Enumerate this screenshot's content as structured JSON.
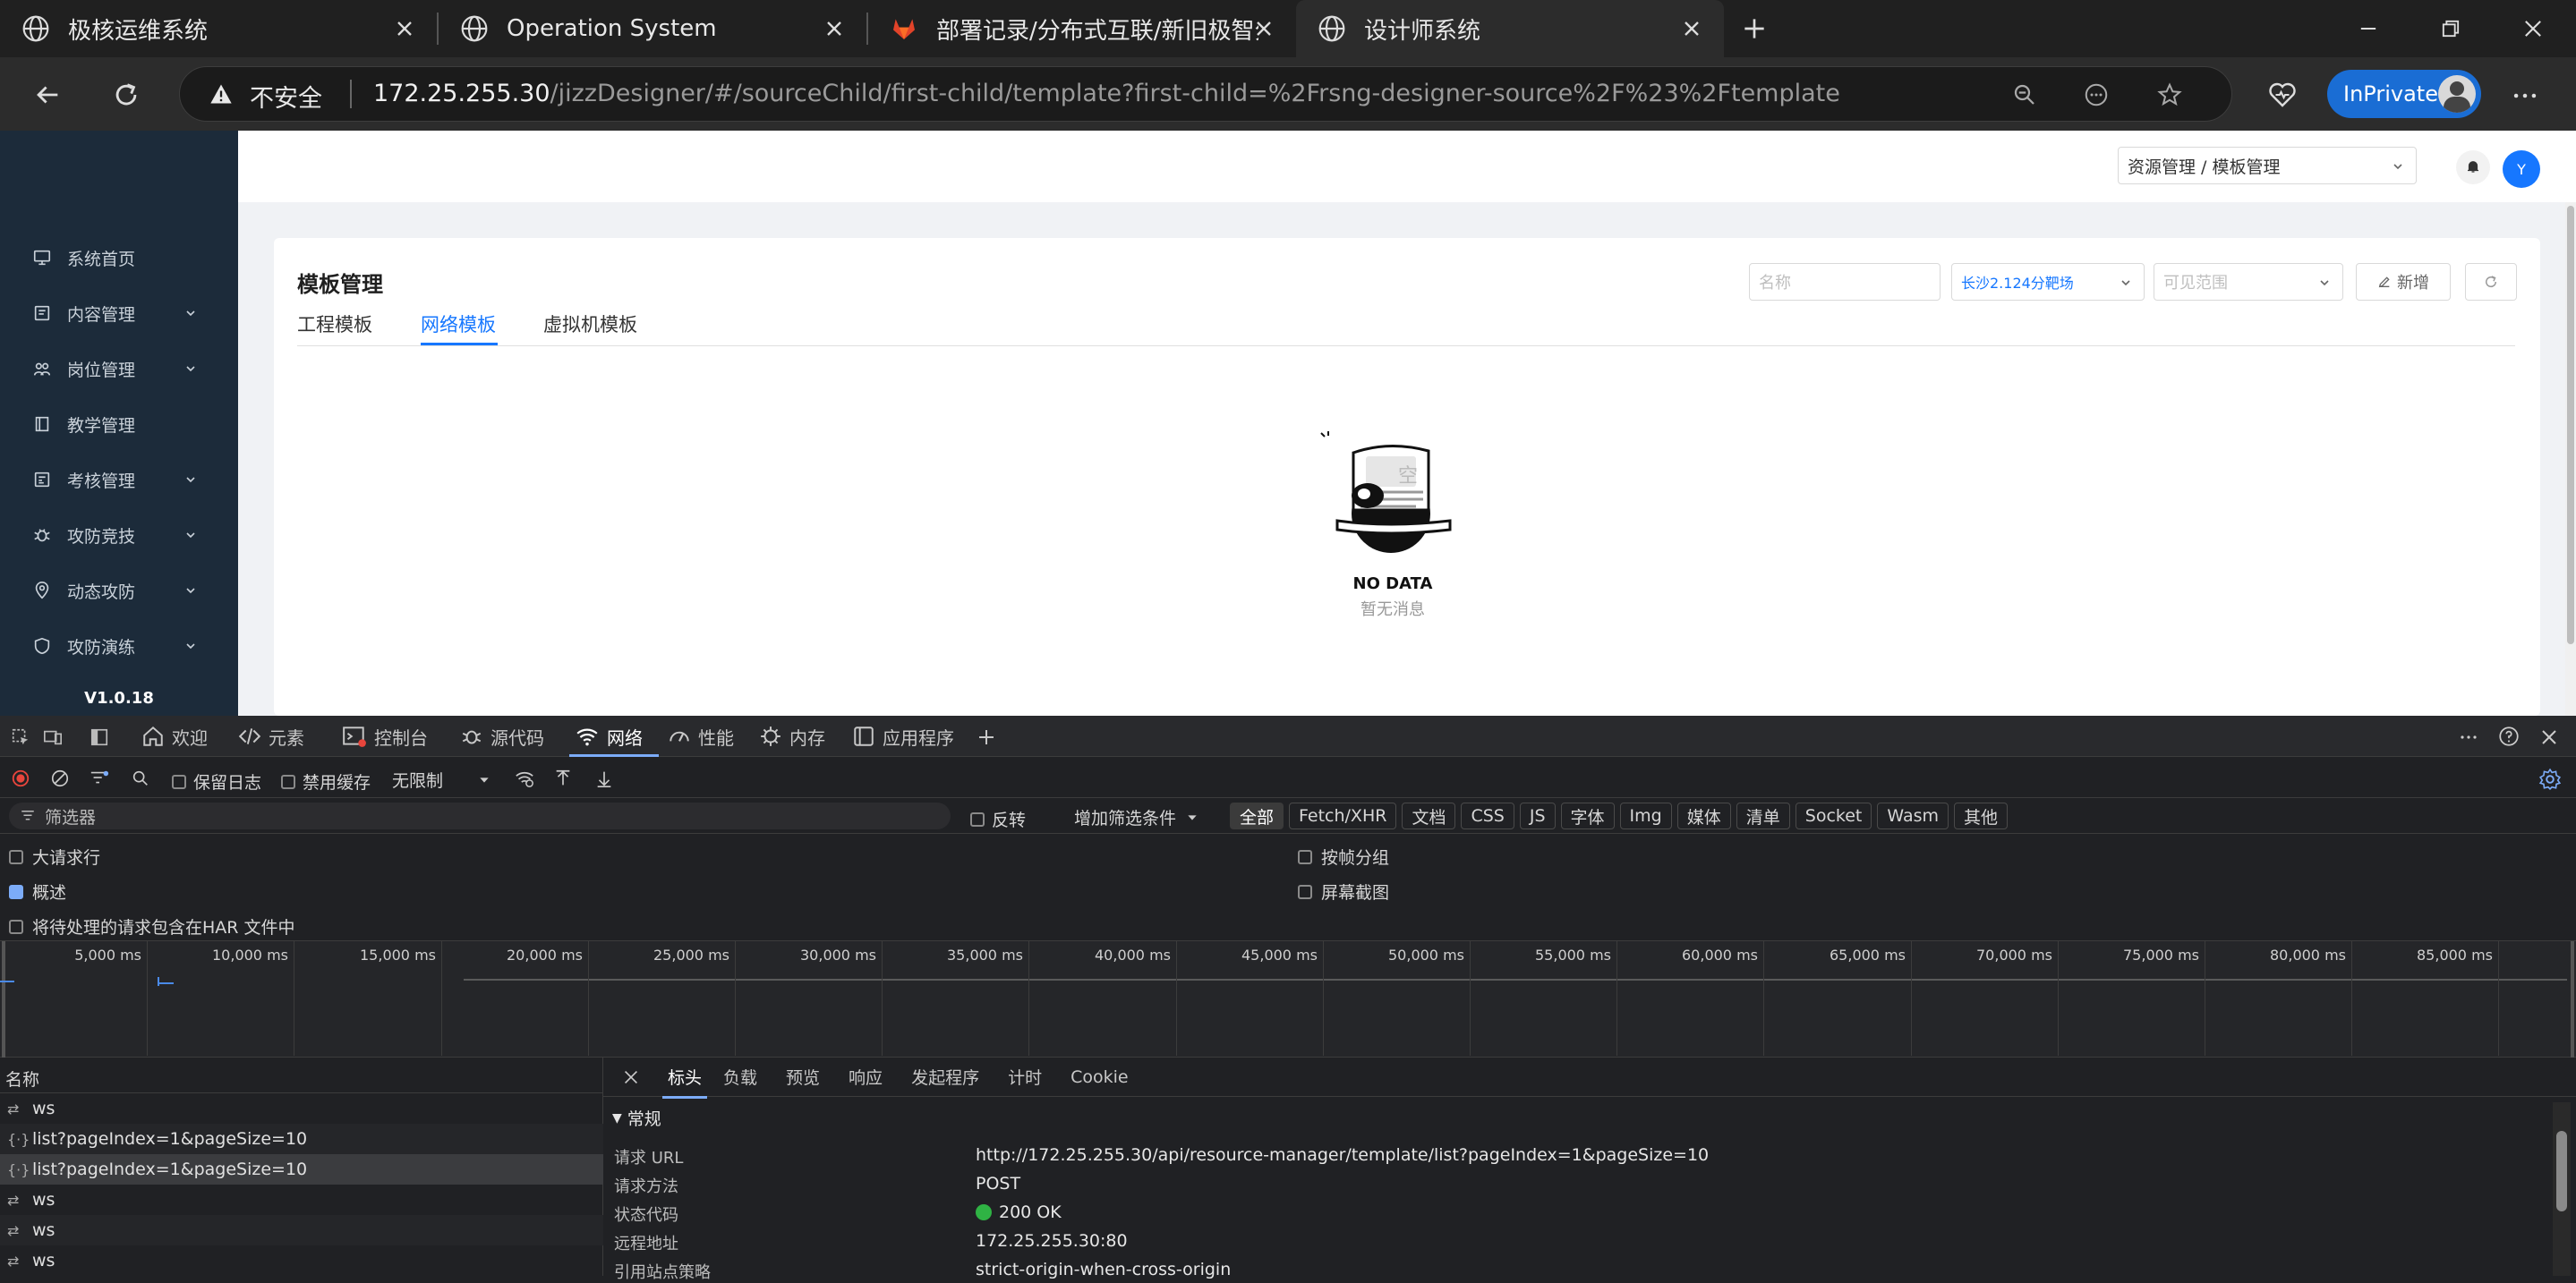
{
  "browser": {
    "tabs": [
      {
        "title": "极核运维系统",
        "active": false
      },
      {
        "title": "Operation System",
        "active": false
      },
      {
        "title": "部署记录/分布式互联/新旧极智分",
        "active": false
      },
      {
        "title": "设计师系统",
        "active": true
      }
    ],
    "security_label": "不安全",
    "url_host": "172.25.255.30",
    "url_path": "/jizzDesigner/#/sourceChild/first-child/template?first-child=%2Frsng-designer-source%2F%23%2Ftemplate",
    "inprivate_label": "InPrivate"
  },
  "app": {
    "sidebar": {
      "items": [
        {
          "label": "系统首页",
          "icon": "monitor-icon",
          "has_children": false
        },
        {
          "label": "内容管理",
          "icon": "folder-icon",
          "has_children": true
        },
        {
          "label": "岗位管理",
          "icon": "users-icon",
          "has_children": true
        },
        {
          "label": "教学管理",
          "icon": "book-icon",
          "has_children": false
        },
        {
          "label": "考核管理",
          "icon": "exam-icon",
          "has_children": true
        },
        {
          "label": "攻防竞技",
          "icon": "bug-icon",
          "has_children": true
        },
        {
          "label": "动态攻防",
          "icon": "target-icon",
          "has_children": true
        },
        {
          "label": "攻防演练",
          "icon": "shield-icon",
          "has_children": true
        }
      ],
      "version": "V1.0.18"
    },
    "header": {
      "breadcrumb_select": "资源管理 / 模板管理",
      "avatar_letter": "Y"
    },
    "card": {
      "title": "模板管理",
      "name_placeholder": "名称",
      "site_select": "长沙2.124分靶场",
      "scope_placeholder": "可见范围",
      "new_button": "新增",
      "tabs": [
        {
          "label": "工程模板",
          "active": false
        },
        {
          "label": "网络模板",
          "active": true
        },
        {
          "label": "虚拟机模板",
          "active": false
        }
      ],
      "empty_badge": "空",
      "empty_title": "NO DATA",
      "empty_subtitle": "暂无消息"
    }
  },
  "devtools": {
    "tabs": [
      {
        "label": "欢迎",
        "icon": "home-icon"
      },
      {
        "label": "元素",
        "icon": "code-icon"
      },
      {
        "label": "控制台",
        "icon": "console-icon"
      },
      {
        "label": "源代码",
        "icon": "bug-icon"
      },
      {
        "label": "网络",
        "icon": "wifi-icon",
        "active": true
      },
      {
        "label": "性能",
        "icon": "performance-icon"
      },
      {
        "label": "内存",
        "icon": "memory-icon"
      },
      {
        "label": "应用程序",
        "icon": "application-icon"
      }
    ],
    "toolbar": {
      "preserve_log": "保留日志",
      "disable_cache": "禁用缓存",
      "throttle": "无限制"
    },
    "filter": {
      "placeholder": "筛选器",
      "invert": "反转",
      "add_filter": "增加筛选条件",
      "types": [
        "全部",
        "Fetch/XHR",
        "文档",
        "CSS",
        "JS",
        "字体",
        "Img",
        "媒体",
        "清单",
        "Socket",
        "Wasm",
        "其他"
      ]
    },
    "options": {
      "large_rows": "大请求行",
      "overview": "概述",
      "har_pending": "将待处理的请求包含在HAR 文件中",
      "group_by_frame": "按帧分组",
      "screenshots": "屏幕截图"
    },
    "timeline_ticks": [
      "5,000 ms",
      "10,000 ms",
      "15,000 ms",
      "20,000 ms",
      "25,000 ms",
      "30,000 ms",
      "35,000 ms",
      "40,000 ms",
      "45,000 ms",
      "50,000 ms",
      "55,000 ms",
      "60,000 ms",
      "65,000 ms",
      "70,000 ms",
      "75,000 ms",
      "80,000 ms",
      "85,000 ms"
    ],
    "requests": {
      "column_name": "名称",
      "rows": [
        {
          "name": "ws",
          "type": "ws",
          "selected": false
        },
        {
          "name": "list?pageIndex=1&pageSize=10",
          "type": "xhr",
          "selected": false
        },
        {
          "name": "list?pageIndex=1&pageSize=10",
          "type": "xhr",
          "selected": true
        },
        {
          "name": "ws",
          "type": "ws",
          "selected": false
        },
        {
          "name": "ws",
          "type": "ws",
          "selected": false
        },
        {
          "name": "ws",
          "type": "ws",
          "selected": false
        }
      ]
    },
    "detail": {
      "tabs": [
        "标头",
        "负载",
        "预览",
        "响应",
        "发起程序",
        "计时",
        "Cookie"
      ],
      "section": "常规",
      "headers": [
        {
          "key": "请求 URL",
          "value": "http://172.25.255.30/api/resource-manager/template/list?pageIndex=1&pageSize=10"
        },
        {
          "key": "请求方法",
          "value": "POST"
        },
        {
          "key": "状态代码",
          "value": "200 OK"
        },
        {
          "key": "远程地址",
          "value": "172.25.255.30:80"
        },
        {
          "key": "引用站点策略",
          "value": "strict-origin-when-cross-origin"
        }
      ]
    }
  },
  "colors": {
    "sidebar_bg": "#1c2b3a",
    "accent": "#1677ff",
    "devtools_bg": "#202124",
    "status_ok": "#2fb344"
  }
}
